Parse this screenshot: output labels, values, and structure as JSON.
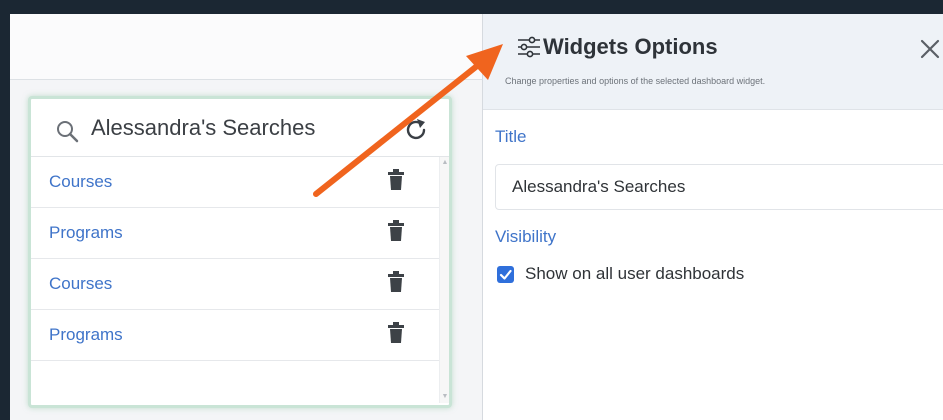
{
  "widget": {
    "title": "Alessandra's Searches",
    "items": [
      {
        "label": "Courses"
      },
      {
        "label": "Programs"
      },
      {
        "label": "Courses"
      },
      {
        "label": "Programs"
      }
    ]
  },
  "panel": {
    "title": "Widgets Options",
    "subtitle": "Change properties and options of the selected dashboard widget.",
    "title_label": "Title",
    "title_value": "Alessandra's Searches",
    "visibility_label": "Visibility",
    "checkbox_label": "Show on all user dashboards",
    "checkbox_checked": true
  },
  "colors": {
    "link": "#3f74c9",
    "accent": "#2f6fdb",
    "arrow": "#f0641e",
    "widget_border": "#c9e4d6"
  },
  "icons": [
    "search-icon",
    "refresh-icon",
    "trash-icon",
    "sliders-icon",
    "close-icon",
    "checkmark-icon"
  ]
}
